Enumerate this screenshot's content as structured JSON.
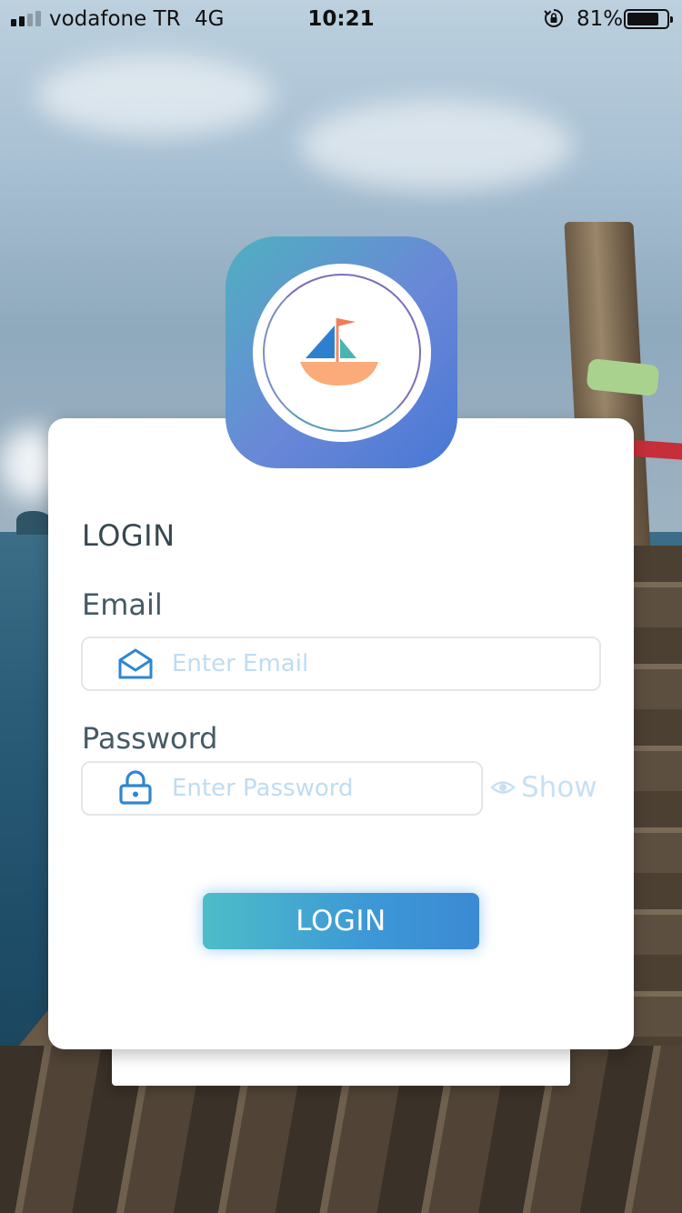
{
  "status_bar": {
    "carrier": "vodafone TR",
    "network": "4G",
    "time": "10:21",
    "battery_percent": "81%",
    "battery_level": 0.81,
    "icons": [
      "signal-icon",
      "orientation-lock-icon",
      "battery-icon"
    ]
  },
  "login_card": {
    "logo_icon": "sailboat-logo-icon",
    "title": "LOGIN",
    "email": {
      "label": "Email",
      "placeholder": "Enter Email",
      "value": "",
      "icon": "envelope-icon"
    },
    "password": {
      "label": "Password",
      "placeholder": "Enter Password",
      "value": "",
      "icon": "lock-icon",
      "show_label": "Show",
      "show_icon": "eye-icon"
    },
    "login_button_label": "LOGIN"
  },
  "colors": {
    "accent": "#3d98d6",
    "button_gradient_start": "#4dbdc8",
    "button_gradient_end": "#3b8ad4",
    "icon_blue": "#2f86d0",
    "placeholder": "#bfdcf2",
    "title_text": "#37474f"
  }
}
